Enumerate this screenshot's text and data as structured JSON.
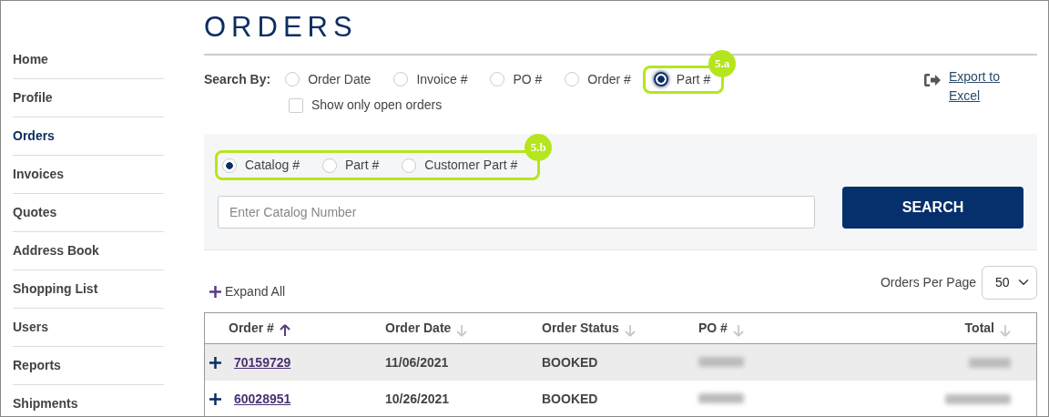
{
  "sidebar": {
    "items": [
      {
        "label": "Home",
        "selected": false
      },
      {
        "label": "Profile",
        "selected": false
      },
      {
        "label": "Orders",
        "selected": true
      },
      {
        "label": "Invoices",
        "selected": false
      },
      {
        "label": "Quotes",
        "selected": false
      },
      {
        "label": "Address Book",
        "selected": false
      },
      {
        "label": "Shopping List",
        "selected": false
      },
      {
        "label": "Users",
        "selected": false
      },
      {
        "label": "Reports",
        "selected": false
      },
      {
        "label": "Shipments",
        "selected": false
      }
    ]
  },
  "page_title": "ORDERS",
  "search_by": {
    "label": "Search By:",
    "options": [
      {
        "label": "Order Date",
        "selected": false
      },
      {
        "label": "Invoice #",
        "selected": false
      },
      {
        "label": "PO #",
        "selected": false
      },
      {
        "label": "Order #",
        "selected": false
      },
      {
        "label": "Part #",
        "selected": true,
        "callout": "5.a"
      }
    ],
    "open_only": {
      "label": "Show only open orders",
      "checked": false
    }
  },
  "export": {
    "label": "Export to Excel"
  },
  "sub_search": {
    "callout": "5.b",
    "options": [
      {
        "label": "Catalog #",
        "selected": true
      },
      {
        "label": "Part #",
        "selected": false
      },
      {
        "label": "Customer Part #",
        "selected": false
      }
    ],
    "placeholder": "Enter Catalog Number",
    "button": "SEARCH"
  },
  "expand_all": "Expand All",
  "per_page": {
    "label": "Orders Per Page",
    "value": "50"
  },
  "table": {
    "columns": [
      {
        "label": "Order #",
        "sorted": true
      },
      {
        "label": "Order Date",
        "sorted": false
      },
      {
        "label": "Order Status",
        "sorted": false
      },
      {
        "label": "PO #",
        "sorted": false
      },
      {
        "label": "Total",
        "sorted": false
      }
    ],
    "rows": [
      {
        "order": "70159729",
        "date": "11/06/2021",
        "status": "BOOKED",
        "po_blurred": true,
        "total_blurred": true
      },
      {
        "order": "60028951",
        "date": "10/26/2021",
        "status": "BOOKED",
        "po_blurred": true,
        "total_blurred": true
      }
    ]
  }
}
